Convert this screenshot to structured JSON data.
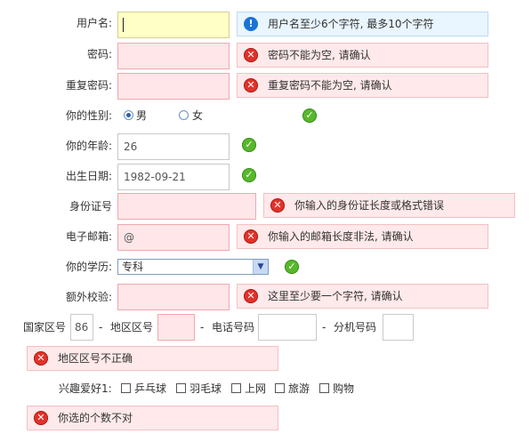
{
  "form": {
    "username": {
      "label": "用户名:",
      "value": "",
      "tip": "用户名至少6个字符, 最多10个字符"
    },
    "password": {
      "label": "密码:",
      "value": "",
      "tip": "密码不能为空, 请确认"
    },
    "password_repeat": {
      "label": "重复密码:",
      "value": "",
      "tip": "重复密码不能为空, 请确认"
    },
    "gender": {
      "label": "你的性别:",
      "options": [
        "男",
        "女"
      ],
      "selected": "男"
    },
    "age": {
      "label": "你的年龄:",
      "value": "26"
    },
    "birthday": {
      "label": "出生日期:",
      "value": "1982-09-21"
    },
    "id_card": {
      "label": "身份证号",
      "value": "",
      "tip": "你输入的身份证长度或格式错误"
    },
    "email": {
      "label": "电子邮箱:",
      "value": "@",
      "tip": "你输入的邮箱长度非法, 请确认"
    },
    "education": {
      "label": "你的学历:",
      "selected": "专科"
    },
    "extra_check": {
      "label": "额外校验:",
      "value": "",
      "tip": "这里至少要一个字符, 请确认"
    },
    "phone": {
      "country_label": "国家区号",
      "country_value": "86",
      "sep1": "-",
      "area_label": "地区区号",
      "area_value": "",
      "sep2": "-",
      "number_label": "电话号码",
      "number_value": "",
      "sep3": "-",
      "ext_label": "分机号码",
      "ext_value": "",
      "tip": "地区区号不正确"
    },
    "hobbies": {
      "label": "兴趣爱好1:",
      "options": [
        "乒乓球",
        "羽毛球",
        "上网",
        "旅游",
        "购物"
      ],
      "tip": "你选的个数不对"
    }
  },
  "icons": {
    "error": "error-x-icon",
    "info": "info-icon",
    "ok": "check-ok-icon"
  },
  "colors": {
    "error_bg": "#ffe9ea",
    "info_bg": "#e9f5ff",
    "focus_bg": "#ffffc6",
    "ok": "#58b82c",
    "error": "#e0322a"
  }
}
